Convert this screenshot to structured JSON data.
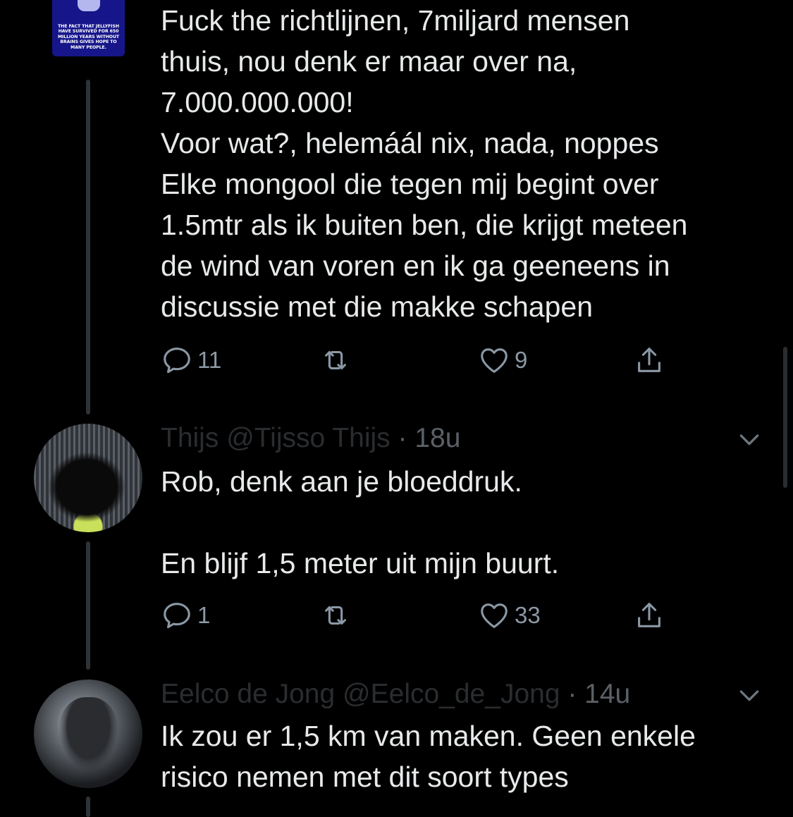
{
  "tweet1": {
    "avatar_text": "THE FACT THAT JELLYFISH HAVE SURVIVED FOR 650 MILLION YEARS WITHOUT BRAINS GIVES HOPE TO MANY PEOPLE.",
    "text": "Fuck the richtlijnen, 7miljard mensen\nthuis, nou denk er maar over na,\n7.000.000.000!\nVoor wat?, helemáál nix, nada, noppes\nElke mongool die tegen mij begint over\n1.5mtr als ik buiten ben, die krijgt meteen\nde wind van voren en ik ga geeneens in\ndiscussie met die makke schapen",
    "replies": "11",
    "retweets": "",
    "likes": "9"
  },
  "reply1": {
    "name": "Thijs",
    "handle": "@Tijsso Thijs",
    "time": "· 18u",
    "text": "Rob, denk aan je bloeddruk.\n\nEn blijf 1,5 meter uit mijn buurt.",
    "replies": "1",
    "retweets": "",
    "likes": "33"
  },
  "reply2": {
    "name": "Eelco de Jong",
    "handle": "@Eelco_de_Jong",
    "time": "· 14u",
    "text": "Ik zou er 1,5 km van maken. Geen enkele\nrisico nemen met dit soort types"
  },
  "colors": {
    "background": "#000000",
    "text": "#e7e9ea",
    "muted": "#8b98a5",
    "thread_line": "#2f3336"
  },
  "icons": [
    "reply-icon",
    "retweet-icon",
    "like-icon",
    "share-icon",
    "chevron-down-icon"
  ]
}
